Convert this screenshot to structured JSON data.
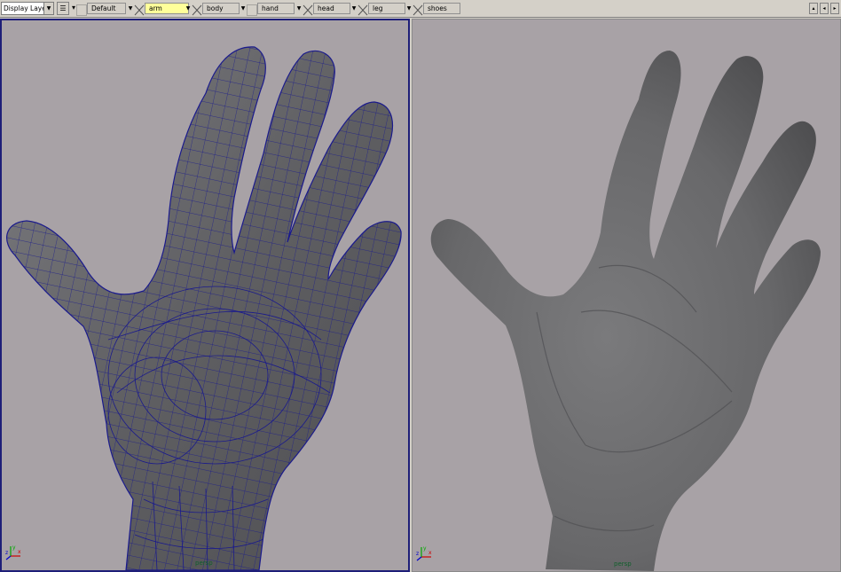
{
  "toolbar": {
    "display_layers_label": "Display Layers",
    "layers": [
      {
        "name": "Default",
        "active": false
      },
      {
        "name": "arm",
        "active": true
      },
      {
        "name": "body",
        "active": false
      },
      {
        "name": "hand",
        "active": false
      },
      {
        "name": "head",
        "active": false
      },
      {
        "name": "leg",
        "active": false
      },
      {
        "name": "shoes",
        "active": false
      }
    ],
    "scroll_up_icon": "scroll-up-arrow",
    "scroll_down_icon": "scroll-down-arrow"
  },
  "viewports": {
    "left": {
      "camera_label": "persp",
      "display_mode": "wireframe-on-shaded"
    },
    "right": {
      "camera_label": "persp",
      "display_mode": "smooth-shaded"
    }
  },
  "colors": {
    "viewport_bg": "#a8a2a6",
    "wireframe": "#1a1a8c",
    "mesh_shade": "#6a6a6c",
    "active_border": "#1e1e78",
    "active_layer_bg": "#ffff9a"
  },
  "axis_gizmo": {
    "x": "x",
    "y": "y",
    "z": "z"
  }
}
